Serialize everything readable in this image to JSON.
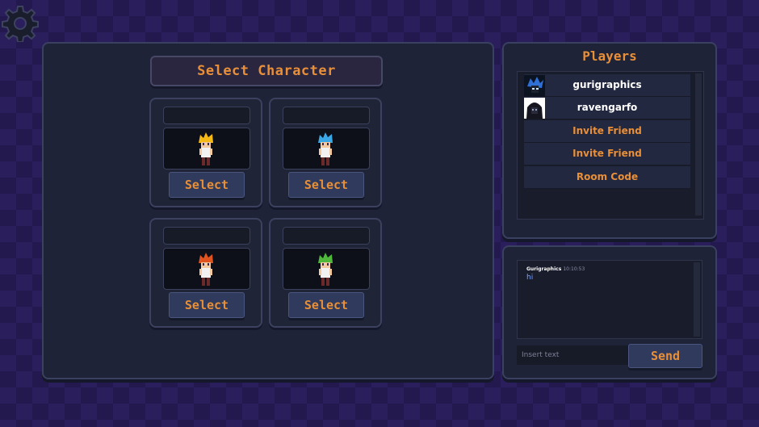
{
  "settings": {
    "icon": "gear-icon"
  },
  "character_select": {
    "title": "Select Character",
    "cards": [
      {
        "name": "",
        "hair_color": "#f5b915",
        "select_label": "Select"
      },
      {
        "name": "",
        "hair_color": "#3aa7e6",
        "select_label": "Select"
      },
      {
        "name": "",
        "hair_color": "#e0521e",
        "select_label": "Select"
      },
      {
        "name": "",
        "hair_color": "#4fb83a",
        "select_label": "Select"
      }
    ]
  },
  "players": {
    "title": "Players",
    "rows": [
      {
        "label": "gurigraphics",
        "type": "player"
      },
      {
        "label": "ravengarfo",
        "type": "player"
      },
      {
        "label": "Invite Friend",
        "type": "action"
      },
      {
        "label": "Invite Friend",
        "type": "action"
      },
      {
        "label": "Room Code",
        "type": "action"
      }
    ]
  },
  "chat": {
    "messages": [
      {
        "author": "Gurigraphics",
        "time": "10:10:53",
        "text": "hi"
      }
    ],
    "input_placeholder": "Insert text",
    "send_label": "Send"
  },
  "colors": {
    "accent": "#e88f37",
    "panel_bg": "#1e2338",
    "button_bg": "#2f3a5c",
    "background": "#2a1f5c"
  }
}
